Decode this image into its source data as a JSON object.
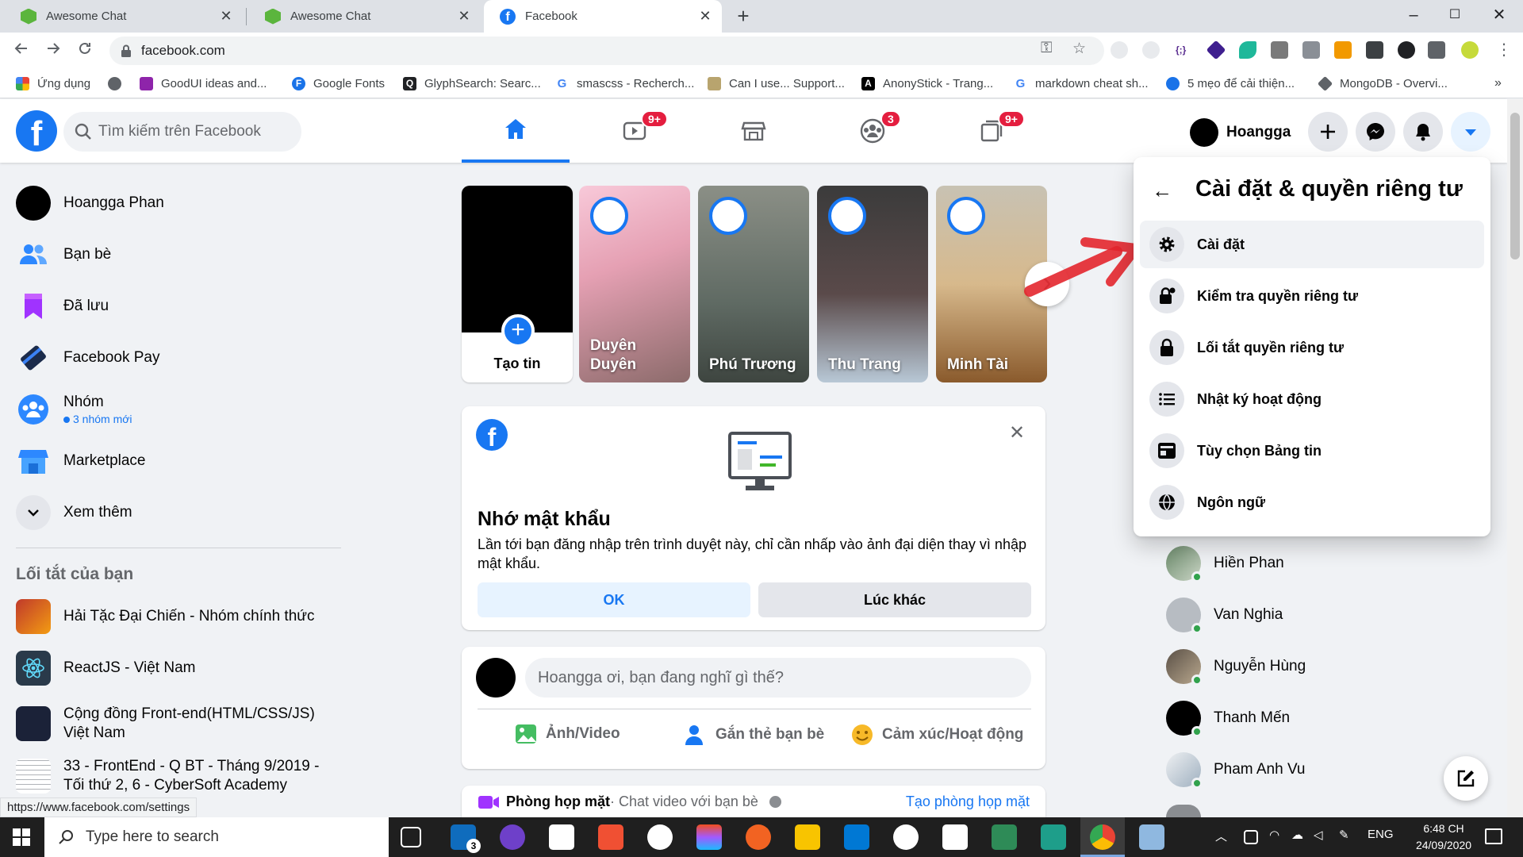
{
  "browser": {
    "tabs": [
      {
        "title": "Awesome Chat",
        "favicon": "hexagon-icon",
        "active": false
      },
      {
        "title": "Awesome Chat",
        "favicon": "hexagon-icon",
        "active": false
      },
      {
        "title": "Facebook",
        "favicon": "facebook-icon",
        "active": true
      }
    ],
    "new_tab": "+",
    "window_controls": {
      "minimize": "–",
      "maximize": "☐",
      "close": "✕"
    },
    "url": "facebook.com",
    "status_url": "https://www.facebook.com/settings",
    "bookmarks": [
      {
        "label": "Ứng dụng",
        "icon": "apps-grid-icon"
      },
      {
        "label": "",
        "icon": "globe-icon"
      },
      {
        "label": "GoodUI ideas and...",
        "icon": "goodui-icon"
      },
      {
        "label": "Google Fonts",
        "icon": "google-fonts-icon"
      },
      {
        "label": "GlyphSearch: Searc...",
        "icon": "glyphsearch-icon"
      },
      {
        "label": "smascss - Recherch...",
        "icon": "google-icon"
      },
      {
        "label": "Can I use... Support...",
        "icon": "caniuse-icon"
      },
      {
        "label": "AnonyStick - Trang...",
        "icon": "anonystick-icon"
      },
      {
        "label": "markdown cheat sh...",
        "icon": "google-icon"
      },
      {
        "label": "5 mẹo để cải thiện...",
        "icon": "refresh-icon"
      },
      {
        "label": "MongoDB - Overvi...",
        "icon": "mongodb-icon"
      }
    ],
    "bookmarks_overflow": "»"
  },
  "fb": {
    "search_placeholder": "Tìm kiếm trên Facebook",
    "nav_badges": {
      "watch": "9+",
      "groups": "3",
      "gaming": "9+"
    },
    "profile_name": "Hoangga",
    "colors": {
      "brand": "#1877f2",
      "badge": "#e41e3f",
      "online": "#31a24c"
    }
  },
  "left_menu": {
    "items": [
      {
        "label": "Hoangga Phan",
        "icon": "avatar"
      },
      {
        "label": "Bạn bè",
        "icon": "friends-icon"
      },
      {
        "label": "Đã lưu",
        "icon": "bookmark-icon"
      },
      {
        "label": "Facebook Pay",
        "icon": "facebook-pay-icon"
      },
      {
        "label": "Nhóm",
        "icon": "groups-icon",
        "sub": "3 nhóm mới"
      },
      {
        "label": "Marketplace",
        "icon": "marketplace-icon"
      },
      {
        "label": "Xem thêm",
        "icon": "chevron-down-icon"
      }
    ],
    "shortcuts_title": "Lối tắt của bạn",
    "shortcuts": [
      {
        "label": "Hải Tặc Đại Chiến - Nhóm chính thức"
      },
      {
        "label": "ReactJS - Việt Nam"
      },
      {
        "label1": "Cộng đồng Front-end(HTML/CSS/JS)",
        "label2": "Việt Nam"
      },
      {
        "label1": "33 - FrontEnd - Q BT - Tháng 9/2019 -",
        "label2": "Tối thứ 2, 6 - CyberSoft Academy"
      }
    ]
  },
  "stories": {
    "create_label": "Tạo tin",
    "items": [
      {
        "name1": "Duyên",
        "name2": "Duyên"
      },
      {
        "name1": "Phú Trương",
        "name2": ""
      },
      {
        "name1": "Thu Trang",
        "name2": ""
      },
      {
        "name1": "Minh Tài",
        "name2": ""
      }
    ],
    "next": "›"
  },
  "password_card": {
    "title": "Nhớ mật khẩu",
    "body": "Lần tới bạn đăng nhập trên trình duyệt này, chỉ cần nhấp vào ảnh đại diện thay vì nhập mật khẩu.",
    "ok_label": "OK",
    "later_label": "Lúc khác",
    "close": "✕"
  },
  "composer": {
    "placeholder": "Hoangga ơi, bạn đang nghĩ gì thế?",
    "actions": [
      "Ảnh/Video",
      "Gắn thẻ bạn bè",
      "Cảm xúc/Hoạt động"
    ]
  },
  "room": {
    "title": "Phòng họp mặt",
    "subtitle": " · Chat video với bạn bè",
    "link": "Tạo phòng họp mặt"
  },
  "dropdown": {
    "title": "Cài đặt & quyền riêng tư",
    "back": "←",
    "items": [
      {
        "label": "Cài đặt",
        "icon": "gear-icon"
      },
      {
        "label": "Kiểm tra quyền riêng tư",
        "icon": "lock-check-icon"
      },
      {
        "label": "Lối tắt quyền riêng tư",
        "icon": "lock-icon"
      },
      {
        "label": "Nhật ký hoạt động",
        "icon": "list-icon"
      },
      {
        "label": "Tùy chọn Bảng tin",
        "icon": "news-feed-icon"
      },
      {
        "label": "Ngôn ngữ",
        "icon": "globe-icon"
      }
    ]
  },
  "contacts": [
    {
      "name": "Hiền Phan"
    },
    {
      "name": "Van Nghia"
    },
    {
      "name": "Nguyễn Hùng"
    },
    {
      "name": "Thanh Mến"
    },
    {
      "name": "Pham Anh Vu"
    }
  ],
  "taskbar": {
    "search_placeholder": "Type here to search",
    "mail_badge": "3",
    "lang": "ENG",
    "time": "6:48 CH",
    "date": "24/09/2020"
  }
}
